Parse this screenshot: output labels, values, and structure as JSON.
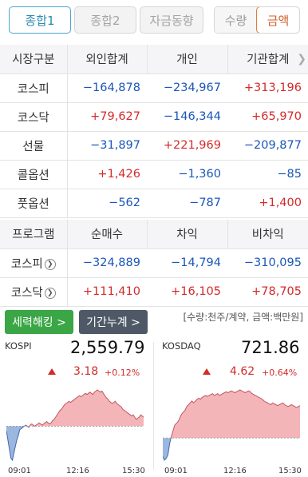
{
  "tabs": [
    {
      "label": "종합1",
      "active": true
    },
    {
      "label": "종합2",
      "active": false
    },
    {
      "label": "자금동향",
      "active": false
    }
  ],
  "toggle": {
    "left": "수량",
    "right": "금액",
    "selected": "금액"
  },
  "investor_table": {
    "headers": [
      "시장구분",
      "외인합계",
      "개인",
      "기관합계"
    ],
    "rows": [
      {
        "label": "코스피",
        "values": [
          "−164,878",
          "−234,967",
          "+313,196"
        ]
      },
      {
        "label": "코스닥",
        "values": [
          "+79,627",
          "−146,344",
          "+65,970"
        ]
      },
      {
        "label": "선물",
        "values": [
          "−31,897",
          "+221,969",
          "−209,877"
        ]
      },
      {
        "label": "콜옵션",
        "values": [
          "+1,426",
          "−1,360",
          "−85"
        ]
      },
      {
        "label": "풋옵션",
        "values": [
          "−562",
          "−787",
          "+1,400"
        ]
      }
    ]
  },
  "program_table": {
    "headers": [
      "프로그램",
      "순매수",
      "차익",
      "비차익"
    ],
    "rows": [
      {
        "label": "코스피",
        "values": [
          "−324,889",
          "−14,794",
          "−310,095"
        ]
      },
      {
        "label": "코스닥",
        "values": [
          "+111,410",
          "+16,105",
          "+78,705"
        ]
      }
    ]
  },
  "buttons": {
    "ranking": "세력해킹 >",
    "period": "기간누계 >"
  },
  "unit_note": "[수량:천주/계약, 금액:백만원]",
  "markets": [
    {
      "name": "KOSPI",
      "value": "2,559.79",
      "change": "3.18",
      "pct": "+0.12%",
      "times": [
        "09:01",
        "12:16",
        "15:30"
      ],
      "series": [
        -4,
        -12,
        -20,
        -28,
        -30,
        -24,
        -18,
        -12,
        -8,
        -3,
        -2,
        -1,
        0,
        1,
        0,
        -1,
        1,
        2,
        1,
        0,
        1,
        2,
        3,
        2,
        1,
        2,
        3,
        4,
        3,
        2,
        3,
        5,
        6,
        8,
        10,
        12,
        14,
        15,
        17,
        19,
        20,
        21,
        22,
        21,
        22,
        23,
        24,
        25,
        26,
        27,
        26,
        27,
        28,
        29,
        28,
        29,
        30,
        29,
        28,
        30,
        31,
        32,
        31,
        30,
        31,
        29,
        27,
        25,
        24,
        22,
        21,
        20,
        21,
        22,
        20,
        19,
        18,
        17,
        15,
        14,
        13,
        12,
        11,
        10,
        9,
        10,
        8,
        6,
        7,
        8,
        10,
        9,
        8
      ]
    },
    {
      "name": "KOSDAQ",
      "value": "721.86",
      "change": "4.62",
      "pct": "+0.64%",
      "times": [
        "09:01",
        "12:16",
        "15:30"
      ],
      "series": [
        -20,
        -24,
        -22,
        -18,
        -6,
        2,
        8,
        14,
        16,
        18,
        22,
        26,
        28,
        30,
        34,
        36,
        38,
        40,
        38,
        40,
        42,
        43,
        42,
        44,
        45,
        46,
        45,
        46,
        47,
        48,
        46,
        47,
        48,
        46,
        47,
        48,
        49,
        50,
        49,
        50,
        51,
        50,
        49,
        50,
        51,
        52,
        51,
        50,
        49,
        50,
        51,
        50,
        48,
        47,
        46,
        45,
        44,
        43,
        42,
        40,
        39,
        38,
        37,
        36,
        38,
        37,
        36,
        35,
        36,
        37,
        38,
        36,
        35,
        34,
        35,
        36,
        35,
        34,
        33,
        34,
        35
      ]
    }
  ],
  "colors": {
    "up": "#d32a2a",
    "down": "#1a56b8",
    "accent": "#4aa6c9",
    "green": "#3aa645"
  }
}
